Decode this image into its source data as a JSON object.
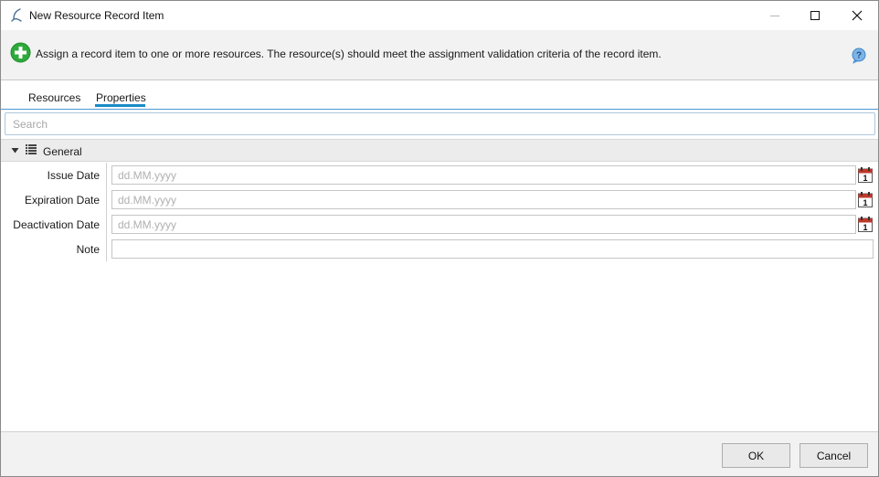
{
  "window": {
    "title": "New Resource Record Item"
  },
  "header": {
    "message": "Assign a record item to one or more resources. The resource(s) should meet the assignment validation criteria of the record item.",
    "add_icon": "add-circle-icon",
    "help_icon": "help-icon"
  },
  "tabs": [
    {
      "label": "Resources",
      "active": false
    },
    {
      "label": "Properties",
      "active": true
    }
  ],
  "search": {
    "placeholder": "Search",
    "value": ""
  },
  "group": {
    "title": "General",
    "expanded": true
  },
  "properties": [
    {
      "label": "Issue Date",
      "placeholder": "dd.MM.yyyy",
      "value": "",
      "has_calendar": true
    },
    {
      "label": "Expiration Date",
      "placeholder": "dd.MM.yyyy",
      "value": "",
      "has_calendar": true
    },
    {
      "label": "Deactivation Date",
      "placeholder": "dd.MM.yyyy",
      "value": "",
      "has_calendar": true
    },
    {
      "label": "Note",
      "placeholder": "",
      "value": "",
      "has_calendar": false
    }
  ],
  "footer": {
    "ok_label": "OK",
    "cancel_label": "Cancel"
  },
  "colors": {
    "accent": "#1b8ac7",
    "add_icon_green": "#2eaa3c",
    "calendar_red": "#c0392b"
  }
}
